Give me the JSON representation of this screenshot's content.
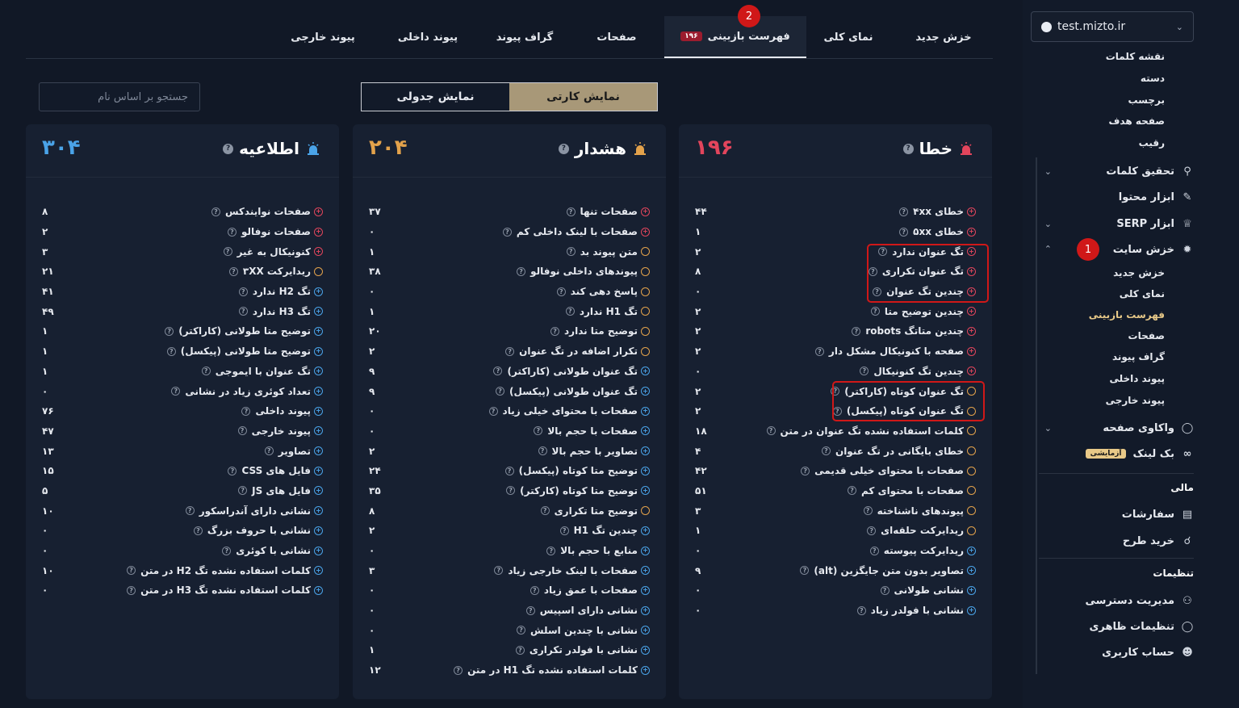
{
  "sidebar": {
    "site": "test.mizto.ir",
    "keyword_subitems": [
      "نقشه کلمات",
      "دسته",
      "برچسب",
      "صفحه هدف",
      "رقیب"
    ],
    "main_items": [
      {
        "label": "تحقیق کلمات",
        "icon": "search-icon"
      },
      {
        "label": "ابزار محتوا",
        "icon": "pencil-icon"
      },
      {
        "label": "ابزار SERP",
        "icon": "trophy-icon"
      },
      {
        "label": "خزش سایت",
        "icon": "bug-icon"
      }
    ],
    "crawl_subitems": [
      "خزش جدید",
      "نمای کلی",
      "فهرست بازبینی",
      "صفحات",
      "گراف پیوند",
      "پیوند داخلی",
      "پیوند خارجی"
    ],
    "analysis": {
      "label": "واکاوی صفحه",
      "icon": "palette-icon"
    },
    "backlink": {
      "label": "بک لینک",
      "badge": "آزمایشی",
      "icon": "link-icon"
    },
    "finance_head": "مالی",
    "finance_items": [
      {
        "label": "سفارشات",
        "icon": "clipboard-icon"
      },
      {
        "label": "خرید طرح",
        "icon": "cart-icon"
      }
    ],
    "settings_head": "تنظیمات",
    "settings_items": [
      {
        "label": "مدیریت دسترسی",
        "icon": "users-icon"
      },
      {
        "label": "تنظیمات ظاهری",
        "icon": "palette-icon"
      },
      {
        "label": "حساب کاربری",
        "icon": "user-icon"
      }
    ],
    "annotation_1": "1"
  },
  "tabs": [
    {
      "label": "خزش جدید"
    },
    {
      "label": "نمای کلی"
    },
    {
      "label": "فهرست بازبینی",
      "count": "۱۹۶",
      "active": true
    },
    {
      "label": "صفحات"
    },
    {
      "label": "گراف پیوند"
    },
    {
      "label": "پیوند داخلی"
    },
    {
      "label": "پیوند خارجی"
    }
  ],
  "annotation_2": "2",
  "view": {
    "card": "نمایش کارتی",
    "table": "نمایش جدولی"
  },
  "search": {
    "placeholder": "جستجو بر اساس نام"
  },
  "colors": {
    "error": "#e2455c",
    "warning": "#e3a24b",
    "info": "#4aa3e8",
    "accent": "#a89878"
  },
  "cards": [
    {
      "key": "error",
      "title": "خطا",
      "total": "۱۹۶",
      "color": "#e2455c",
      "rows": [
        {
          "label": "خطای ۴xx",
          "type": "err",
          "value": "۴۴"
        },
        {
          "label": "خطای ۵xx",
          "type": "err",
          "value": "۱"
        },
        {
          "label": "تگ عنوان ندارد",
          "type": "err",
          "value": "۲"
        },
        {
          "label": "تگ عنوان تکراری",
          "type": "err",
          "value": "۸"
        },
        {
          "label": "چندین تگ عنوان",
          "type": "err",
          "value": "۰"
        },
        {
          "label": "چندین توضیح متا",
          "type": "err",
          "value": "۲"
        },
        {
          "label": "چندین متاتگ robots",
          "type": "err",
          "value": "۲"
        },
        {
          "label": "صفحه با کنونیکال مشکل دار",
          "type": "err",
          "value": "۲"
        },
        {
          "label": "چندین تگ کنونیکال",
          "type": "err",
          "value": "۰"
        },
        {
          "label": "تگ عنوان کوتاه (کاراکتر)",
          "type": "warn",
          "value": "۲"
        },
        {
          "label": "تگ عنوان کوتاه (پیکسل)",
          "type": "warn",
          "value": "۲"
        },
        {
          "label": "کلمات استفاده نشده تگ عنوان در متن",
          "type": "warn",
          "value": "۱۸"
        },
        {
          "label": "خطای بایگانی در تگ عنوان",
          "type": "warn",
          "value": "۴"
        },
        {
          "label": "صفحات با محتوای خیلی قدیمی",
          "type": "warn",
          "value": "۴۲"
        },
        {
          "label": "صفحات با محتوای کم",
          "type": "warn",
          "value": "۵۱"
        },
        {
          "label": "پیوندهای ناشناخته",
          "type": "warn",
          "value": "۳"
        },
        {
          "label": "ریدایرکت حلقه‌ای",
          "type": "warn",
          "value": "۱"
        },
        {
          "label": "ریدایرکت پیوسته",
          "type": "info",
          "value": "۰"
        },
        {
          "label": "تصاویر بدون متن جایگزین (alt)",
          "type": "info",
          "value": "۹"
        },
        {
          "label": "نشانی طولانی",
          "type": "info",
          "value": "۰"
        },
        {
          "label": "نشانی با فولدر زیاد",
          "type": "info",
          "value": "۰"
        }
      ]
    },
    {
      "key": "warning",
      "title": "هشدار",
      "total": "۲۰۴",
      "color": "#e3a24b",
      "rows": [
        {
          "label": "صفحات تنها",
          "type": "err",
          "value": "۳۷"
        },
        {
          "label": "صفحات با لینک داخلی کم",
          "type": "err",
          "value": "۰"
        },
        {
          "label": "متن پیوند بد",
          "type": "warn",
          "value": "۱"
        },
        {
          "label": "پیوندهای داخلی نوفالو",
          "type": "warn",
          "value": "۳۸"
        },
        {
          "label": "پاسخ دهی کند",
          "type": "warn",
          "value": "۰"
        },
        {
          "label": "تگ H1 ندارد",
          "type": "warn",
          "value": "۱"
        },
        {
          "label": "توضیح متا ندارد",
          "type": "warn",
          "value": "۲۰"
        },
        {
          "label": "تکرار اضافه در تگ عنوان",
          "type": "warn",
          "value": "۲"
        },
        {
          "label": "تگ عنوان طولانی (کاراکتر)",
          "type": "info",
          "value": "۹"
        },
        {
          "label": "تگ عنوان طولانی (پیکسل)",
          "type": "info",
          "value": "۹"
        },
        {
          "label": "صفحات با محتوای خیلی زیاد",
          "type": "info",
          "value": "۰"
        },
        {
          "label": "صفحات با حجم بالا",
          "type": "info",
          "value": "۰"
        },
        {
          "label": "تصاویر با حجم بالا",
          "type": "info",
          "value": "۲"
        },
        {
          "label": "توضیح متا کوتاه (پیکسل)",
          "type": "info",
          "value": "۲۴"
        },
        {
          "label": "توضیح متا کوتاه (کارکتر)",
          "type": "info",
          "value": "۳۵"
        },
        {
          "label": "توضیح متا تکراری",
          "type": "warn",
          "value": "۸"
        },
        {
          "label": "چندین تگ H1",
          "type": "info",
          "value": "۲"
        },
        {
          "label": "منابع با حجم بالا",
          "type": "info",
          "value": "۰"
        },
        {
          "label": "صفحات با لینک خارجی زیاد",
          "type": "info",
          "value": "۳"
        },
        {
          "label": "صفحات با عمق زیاد",
          "type": "info",
          "value": "۰"
        },
        {
          "label": "نشانی دارای اسپیس",
          "type": "info",
          "value": "۰"
        },
        {
          "label": "نشانی با چندین اسلش",
          "type": "info",
          "value": "۰"
        },
        {
          "label": "نشانی با فولدر تکراری",
          "type": "info",
          "value": "۱"
        },
        {
          "label": "کلمات استفاده نشده تگ H1 در متن",
          "type": "info",
          "value": "۱۲"
        }
      ]
    },
    {
      "key": "info",
      "title": "اطلاعیه",
      "total": "۳۰۴",
      "color": "#4aa3e8",
      "rows": [
        {
          "label": "صفحات نوایندکس",
          "type": "err",
          "value": "۸"
        },
        {
          "label": "صفحات نوفالو",
          "type": "err",
          "value": "۲"
        },
        {
          "label": "کنونیکال به غیر",
          "type": "err",
          "value": "۳"
        },
        {
          "label": "ریدایرکت ۳XX",
          "type": "warn",
          "value": "۲۱"
        },
        {
          "label": "تگ H2 ندارد",
          "type": "info",
          "value": "۴۱"
        },
        {
          "label": "تگ H3 ندارد",
          "type": "info",
          "value": "۴۹"
        },
        {
          "label": "توضیح متا طولانی (کاراکتر)",
          "type": "info",
          "value": "۱"
        },
        {
          "label": "توضیح متا طولانی (پیکسل)",
          "type": "info",
          "value": "۱"
        },
        {
          "label": "تگ عنوان با ایموجی",
          "type": "info",
          "value": "۱"
        },
        {
          "label": "تعداد کوئری زیاد در نشانی",
          "type": "info",
          "value": "۰"
        },
        {
          "label": "پیوند داخلی",
          "type": "info",
          "value": "۷۶"
        },
        {
          "label": "پیوند خارجی",
          "type": "info",
          "value": "۴۷"
        },
        {
          "label": "تصاویر",
          "type": "info",
          "value": "۱۳"
        },
        {
          "label": "فایل های CSS",
          "type": "info",
          "value": "۱۵"
        },
        {
          "label": "فایل های JS",
          "type": "info",
          "value": "۵"
        },
        {
          "label": "نشانی دارای آندراسکور",
          "type": "info",
          "value": "۱۰"
        },
        {
          "label": "نشانی با حروف بزرگ",
          "type": "info",
          "value": "۰"
        },
        {
          "label": "نشانی با کوئری",
          "type": "info",
          "value": "۰"
        },
        {
          "label": "کلمات استفاده نشده تگ H2 در متن",
          "type": "info",
          "value": "۱۰"
        },
        {
          "label": "کلمات استفاده نشده تگ H3 در متن",
          "type": "info",
          "value": "۰"
        }
      ]
    }
  ]
}
